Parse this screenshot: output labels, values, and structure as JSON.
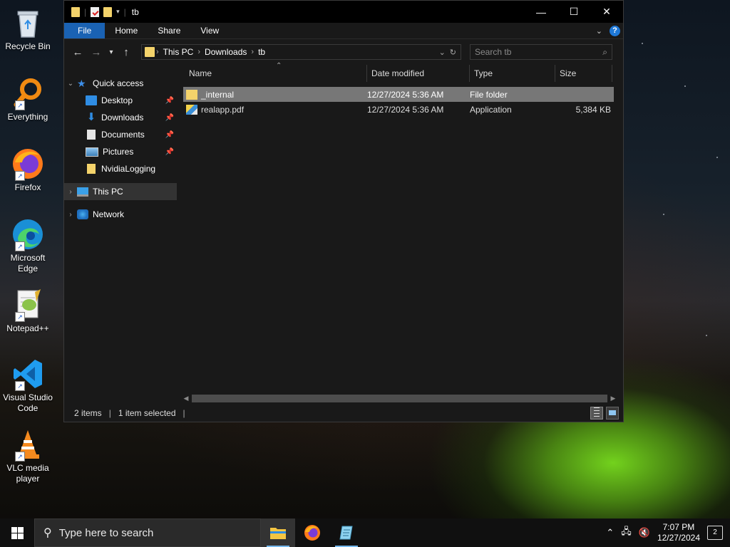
{
  "desktop": {
    "icons": [
      {
        "label": "Recycle Bin"
      },
      {
        "label": "Everything"
      },
      {
        "label": "Firefox"
      },
      {
        "label": "Microsoft Edge"
      },
      {
        "label": "Notepad++"
      },
      {
        "label": "Visual Studio Code"
      },
      {
        "label": "VLC media player"
      }
    ]
  },
  "window": {
    "title": "tb",
    "ribbon_tabs": {
      "file": "File",
      "home": "Home",
      "share": "Share",
      "view": "View"
    },
    "breadcrumb": [
      "This PC",
      "Downloads",
      "tb"
    ],
    "search_placeholder": "Search tb",
    "sidebar": [
      {
        "label": "Quick access",
        "icon": "star-icon"
      },
      {
        "label": "Desktop",
        "icon": "desktop-folder-icon"
      },
      {
        "label": "Downloads",
        "icon": "downloads-folder-icon"
      },
      {
        "label": "Documents",
        "icon": "documents-folder-icon"
      },
      {
        "label": "Pictures",
        "icon": "pictures-folder-icon"
      },
      {
        "label": "NvidiaLogging",
        "icon": "folder-icon"
      },
      {
        "label": "This PC",
        "icon": "computer-icon"
      },
      {
        "label": "Network",
        "icon": "network-icon"
      }
    ],
    "columns": {
      "name": "Name",
      "date": "Date modified",
      "type": "Type",
      "size": "Size"
    },
    "files": [
      {
        "name": "_internal",
        "date": "12/27/2024 5:36 AM",
        "type": "File folder",
        "size": "",
        "selected": true
      },
      {
        "name": "realapp.pdf",
        "date": "12/27/2024 5:36 AM",
        "type": "Application",
        "size": "5,384 KB",
        "selected": false
      }
    ],
    "status": {
      "items": "2 items",
      "selected": "1 item selected"
    }
  },
  "taskbar": {
    "search_placeholder": "Type here to search",
    "time": "7:07 PM",
    "date": "12/27/2024",
    "notifications": "2"
  },
  "colors": {
    "accent": "#1a62b3",
    "selection": "#777777",
    "tent_glow": "#7bd324"
  }
}
